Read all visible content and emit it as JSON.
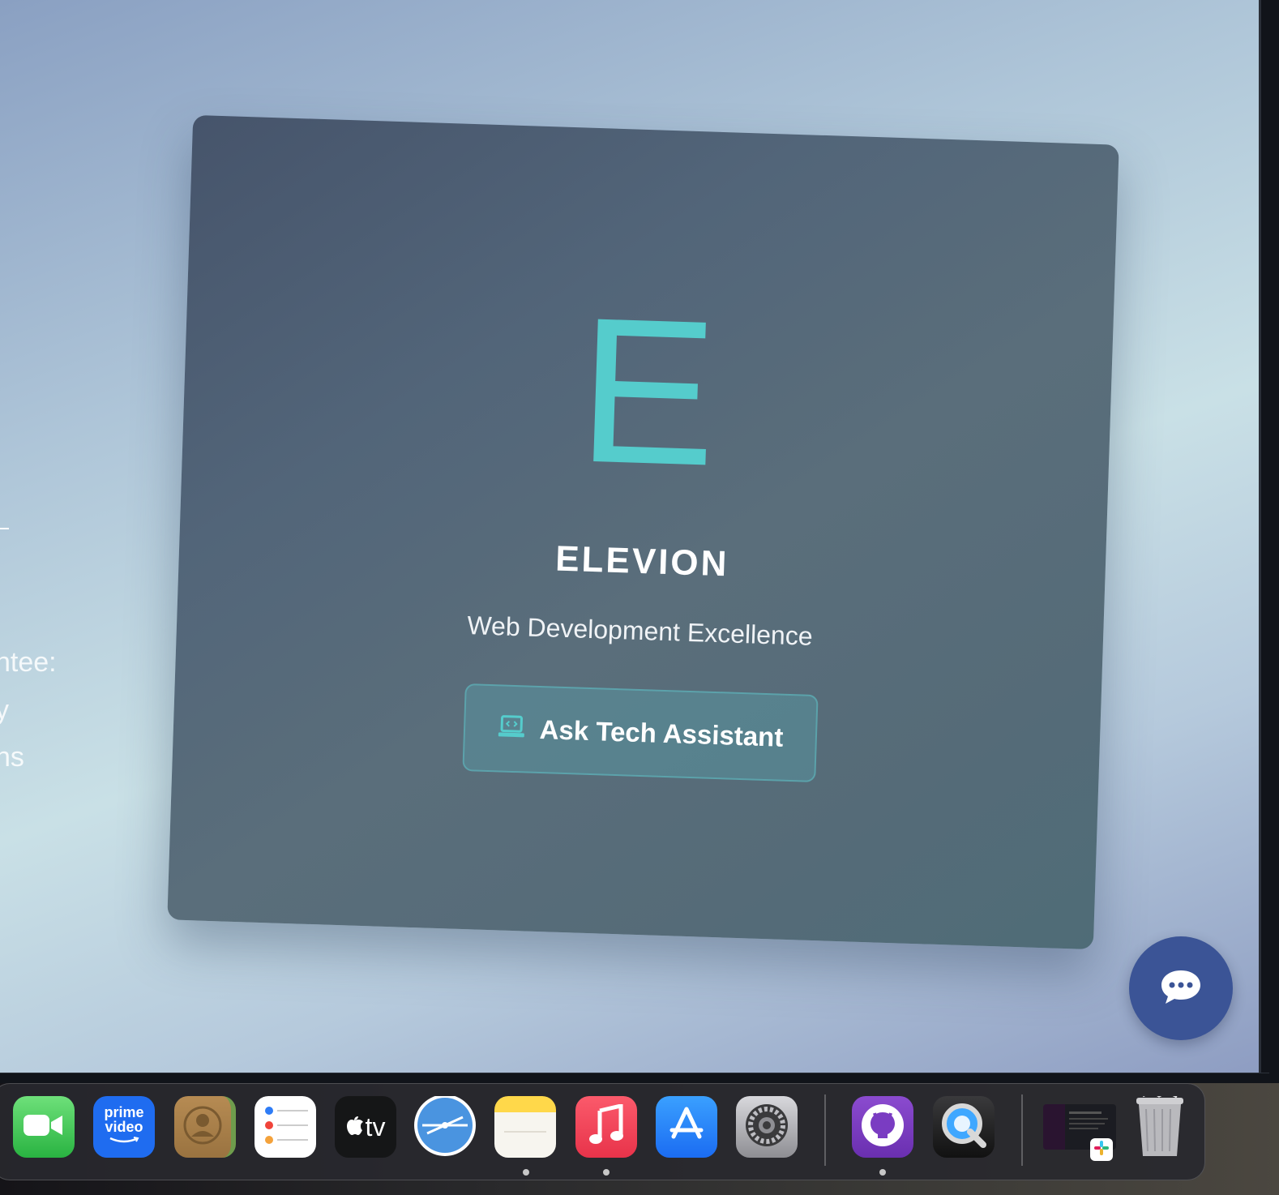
{
  "background_page": {
    "partial_lines": [
      "ntee:",
      "y",
      "ns"
    ]
  },
  "card": {
    "logo_letter": "E",
    "brand": "ELEVION",
    "tagline": "Web Development Excellence",
    "button_label": "Ask Tech Assistant",
    "button_icon": "laptop-code-icon",
    "accent_color": "#55cccc"
  },
  "chat_fab": {
    "icon": "chat-bubble-icon",
    "color": "#3b5496"
  },
  "dock": {
    "apps": [
      {
        "name": "FaceTime",
        "running": false
      },
      {
        "name": "Prime Video",
        "label": "prime video",
        "running": false
      },
      {
        "name": "Contacts",
        "running": false
      },
      {
        "name": "Reminders",
        "running": false
      },
      {
        "name": "Apple TV",
        "label": "tv",
        "running": false
      },
      {
        "name": "Safari",
        "running": false
      },
      {
        "name": "Notes",
        "running": true
      },
      {
        "name": "Music",
        "running": true
      },
      {
        "name": "App Store",
        "running": false
      },
      {
        "name": "System Settings",
        "running": false
      },
      {
        "name": "GitHub Desktop",
        "running": true
      },
      {
        "name": "QuickTime Player",
        "running": false
      },
      {
        "name": "Slack",
        "running": false
      },
      {
        "name": "Trash",
        "running": false
      }
    ]
  }
}
